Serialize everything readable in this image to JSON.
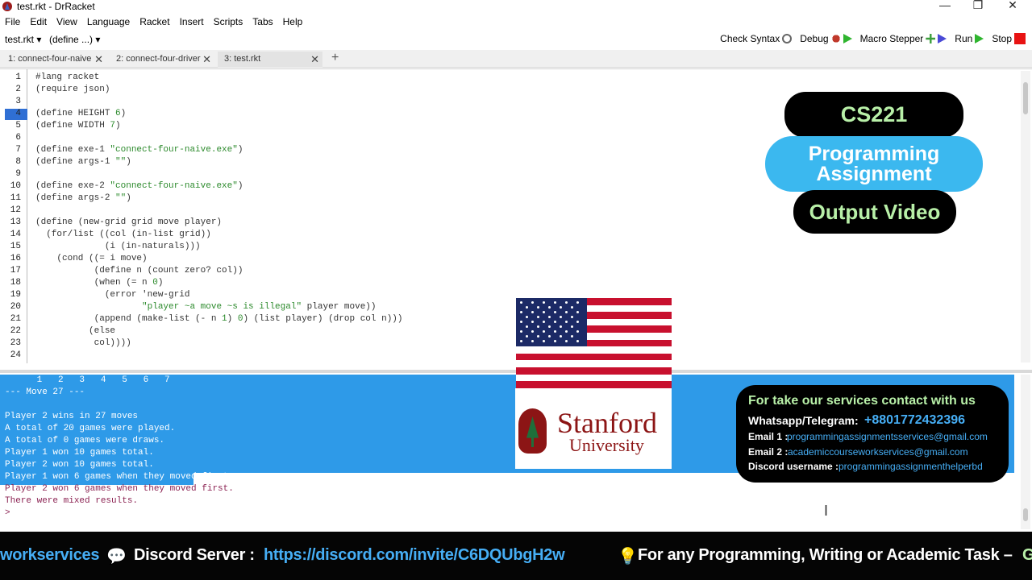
{
  "window": {
    "title": "test.rkt - DrRacket",
    "minimize": "—",
    "maximize": "❐",
    "close": "✕"
  },
  "menu": [
    "File",
    "Edit",
    "View",
    "Language",
    "Racket",
    "Insert",
    "Scripts",
    "Tabs",
    "Help"
  ],
  "toolbar": {
    "file_menu": "test.rkt ▾",
    "define_menu": "(define ...) ▾",
    "check_syntax": "Check Syntax",
    "debug": "Debug",
    "macro_stepper": "Macro Stepper",
    "run": "Run",
    "stop": "Stop"
  },
  "tabs": [
    {
      "label": "1: connect-four-naive",
      "close": "✕"
    },
    {
      "label": "2: connect-four-driver",
      "close": "✕"
    },
    {
      "label": "3: test.rkt",
      "close": "✕"
    }
  ],
  "tab_add": "+",
  "editor": {
    "line_numbers": [
      "1",
      "2",
      "3",
      "4",
      "5",
      "6",
      "7",
      "8",
      "9",
      "10",
      "11",
      "12",
      "13",
      "14",
      "15",
      "16",
      "17",
      "18",
      "19",
      "20",
      "21",
      "22",
      "23",
      "24"
    ],
    "lines": [
      "#lang racket",
      "(require json)",
      "",
      "(define HEIGHT 6)",
      "(define WIDTH 7)",
      "",
      "(define exe-1 \"connect-four-naive.exe\")",
      "(define args-1 \"\")",
      "",
      "(define exe-2 \"connect-four-naive.exe\")",
      "(define args-2 \"\")",
      "",
      "(define (new-grid grid move player)",
      "  (for/list ((col (in-list grid))",
      "             (i (in-naturals)))",
      "    (cond ((= i move)",
      "           (define n (count zero? col))",
      "           (when (= n 0)",
      "             (error 'new-grid",
      "                    \"player ~a move ~s is illegal\" player move))",
      "           (append (make-list (- n 1) 0) (list player) (drop col n)))",
      "          (else",
      "           col))))",
      ""
    ]
  },
  "output": [
    "      1   2   3   4   5   6   7",
    "--- Move 27 ---",
    "",
    "Player 2 wins in 27 moves",
    "A total of 20 games were played.",
    "A total of 0 games were draws.",
    "Player 1 won 10 games total.",
    "Player 2 won 10 games total.",
    "Player 1 won 6 games when they moved first.",
    "Player 2 won 6 games when they moved first.",
    "There were mixed results.",
    ">"
  ],
  "badges": {
    "course": "CS221",
    "assignment": "Programming Assignment",
    "output": "Output Video"
  },
  "stanford": {
    "name": "Stanford",
    "sub": "University"
  },
  "contact": {
    "heading": "For take our services contact with us",
    "whatsapp_label": "Whatsapp/Telegram:",
    "whatsapp_value": "+8801772432396",
    "email1_label": "Email 1 :",
    "email1_value": "programmingassignmentsservices@gmail.com",
    "email2_label": "Email 2 :",
    "email2_value": "academiccourseworkservices@gmail.com",
    "discord_label": "Discord username :",
    "discord_value": "programmingassignmenthelperbd"
  },
  "ticker": {
    "part1": "workservices",
    "discord_icon": "💬",
    "part2": "Discord Server :",
    "link": "https://discord.com/invite/C6DQUbgH2w",
    "bulb": "💡",
    "part3": "For any Programming, Writing or Academic Task –",
    "part4": "G"
  },
  "colors": {
    "accent_blue": "#2e9ae8",
    "badge_black": "#000000",
    "badge_blue": "#3bb8ef",
    "badge_green": "#b8f0a8",
    "link_blue": "#46aef5",
    "stanford_red": "#8c1515"
  }
}
